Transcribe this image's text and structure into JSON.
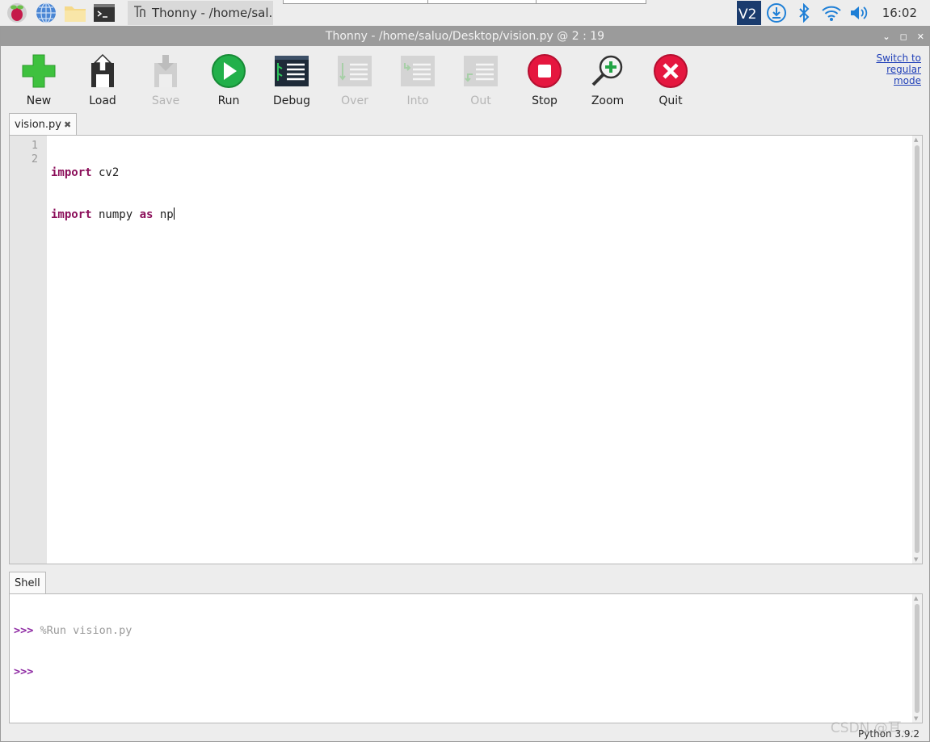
{
  "taskbar": {
    "task_button_label": "Thonny  -  /home/sal...",
    "clock": "16:02",
    "tray_vnc_label": "V2"
  },
  "window": {
    "title": "Thonny  -  /home/saluo/Desktop/vision.py  @  2 : 19"
  },
  "toolbar": {
    "new": "New",
    "load": "Load",
    "save": "Save",
    "run": "Run",
    "debug": "Debug",
    "over": "Over",
    "into": "Into",
    "out": "Out",
    "stop": "Stop",
    "zoom": "Zoom",
    "quit": "Quit",
    "switch_line1": "Switch to",
    "switch_line2": "regular",
    "switch_line3": "mode"
  },
  "editor": {
    "tab_label": "vision.py",
    "tab_close": "✖",
    "lines": [
      {
        "num": "1",
        "kw": "import",
        "rest": " cv2"
      },
      {
        "num": "2",
        "kw": "import",
        "rest_a": " numpy ",
        "kw2": "as",
        "rest_b": " np"
      }
    ]
  },
  "shell": {
    "tab_label": "Shell",
    "prompt": ">>>",
    "run_command": "%Run vision.py"
  },
  "status": {
    "interpreter": "Python 3.9.2"
  },
  "watermark": "CSDN @耳...",
  "colors": {
    "keyword": "#8b0f5a",
    "prompt": "#8e2aa3",
    "link": "#1f3fb8"
  }
}
